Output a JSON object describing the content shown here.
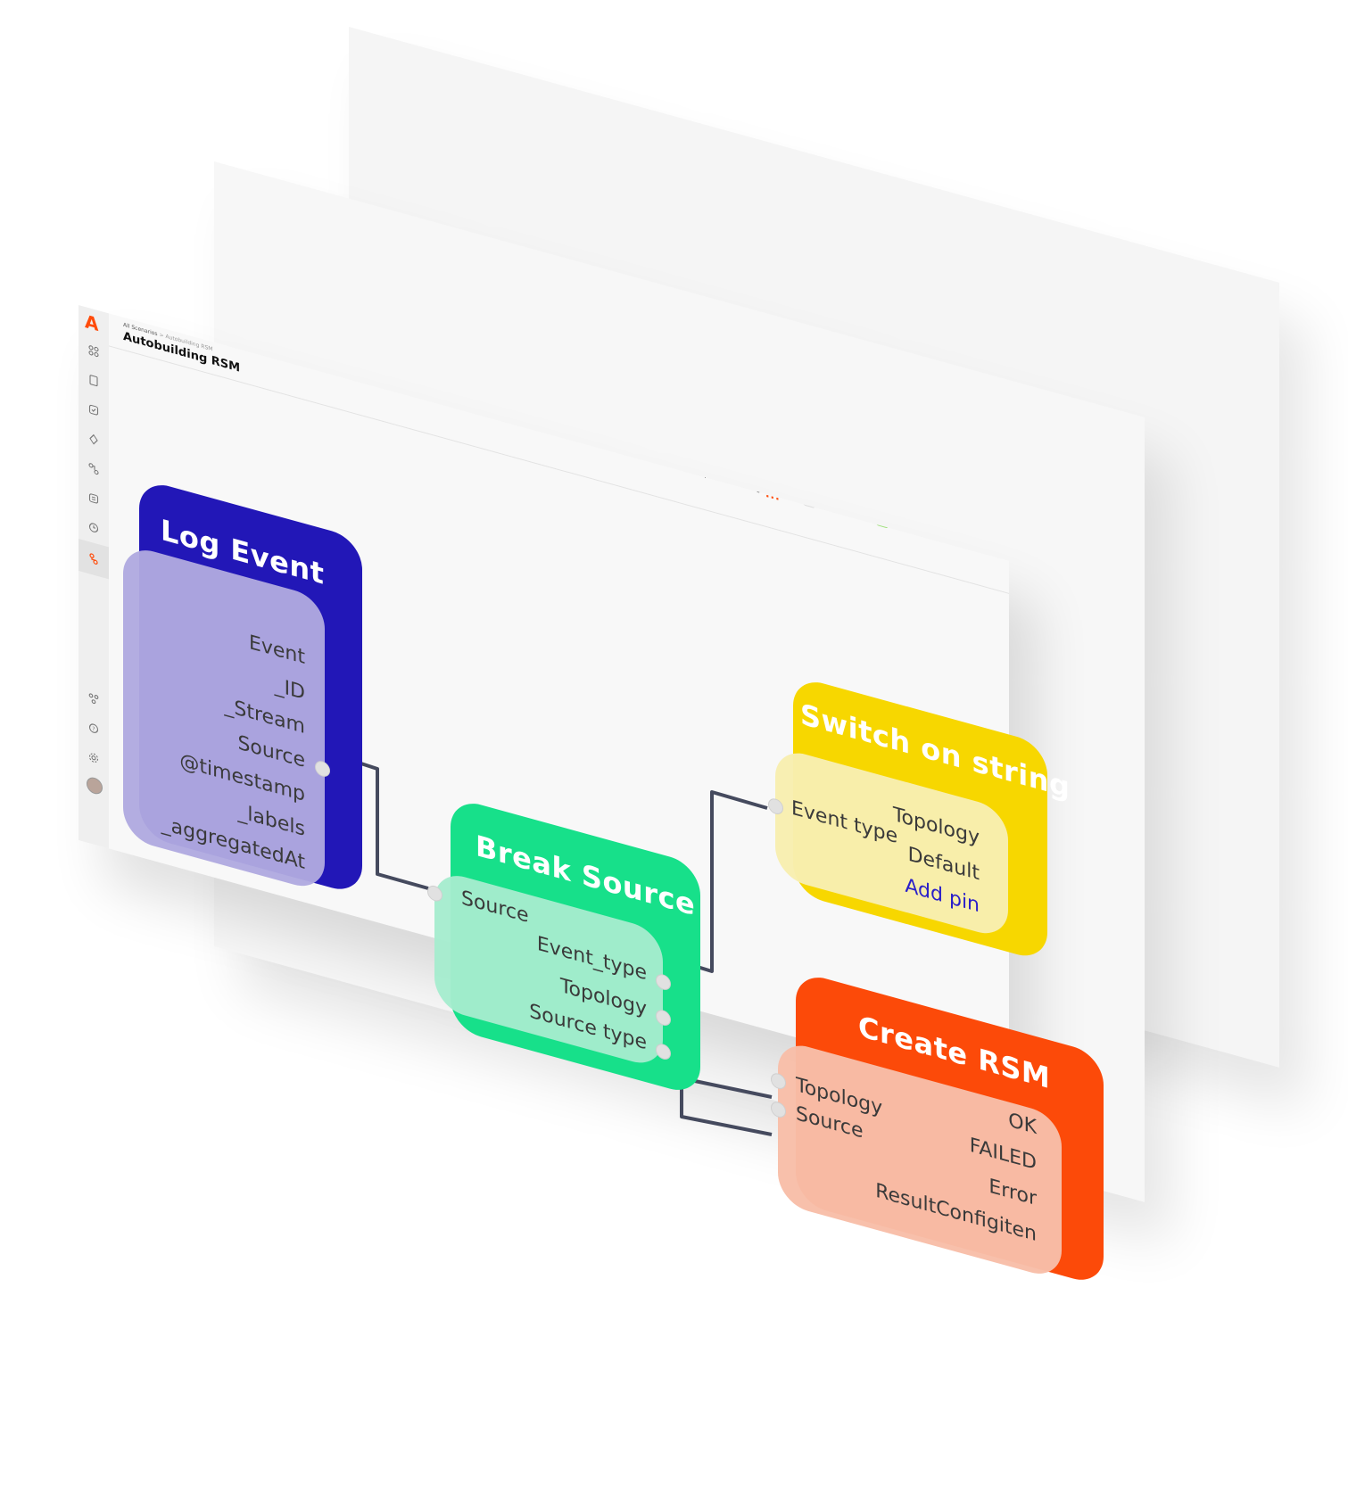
{
  "app": {
    "logo": "A",
    "breadcrumb": {
      "root": "All Scenarios",
      "separator": ">",
      "current": "Autobuilding RSM"
    },
    "page_title": "Autobuilding RSM",
    "toolbar": {
      "compile_label": "Compile",
      "debug_label": "Debug",
      "more": "...",
      "status_label": "Active",
      "profile_badge": "P",
      "menu": "⋮"
    },
    "accent_color": "#ff4b0a"
  },
  "sidebar": {
    "icons": [
      "dashboard-icon",
      "file-icon",
      "checklist-icon",
      "pin-icon",
      "flow-icon",
      "calendar-icon",
      "clock-icon",
      "scenario-icon",
      "team-icon",
      "help-icon",
      "settings-icon",
      "avatar"
    ]
  },
  "nodes": {
    "log_event": {
      "title": "Log Event",
      "color": "#2217b7",
      "outputs": [
        "Event",
        "_ID",
        "_Stream",
        "Source",
        "@timestamp",
        "_labels",
        "_aggregatedAt"
      ]
    },
    "break_source": {
      "title": "Break Source",
      "color": "#17e08a",
      "inputs": [
        "Source"
      ],
      "outputs": [
        "Event_type",
        "Topology",
        "Source type"
      ]
    },
    "switch_on_string": {
      "title": "Switch on string",
      "color": "#f7d700",
      "inputs": [
        "Event type"
      ],
      "outputs": [
        "Topology",
        "Default"
      ],
      "add_pin_label": "Add pin",
      "add_pin_color": "#2a1fc9"
    },
    "create_rsm": {
      "title": "Create RSM",
      "color": "#fc4a09",
      "inputs": [
        "Topology",
        "Source"
      ],
      "outputs": [
        "OK",
        "FAILED",
        "Error",
        "ResultConfigiten"
      ]
    }
  },
  "connections": [
    {
      "from": "Log Event.Source",
      "to": "Break Source.Source"
    },
    {
      "from": "Break Source.Event_type",
      "to": "Switch on string.Event type"
    },
    {
      "from": "Break Source.Topology",
      "to": "Create RSM.Topology"
    },
    {
      "from": "Break Source.Source type",
      "to": "Create RSM.Source"
    }
  ]
}
